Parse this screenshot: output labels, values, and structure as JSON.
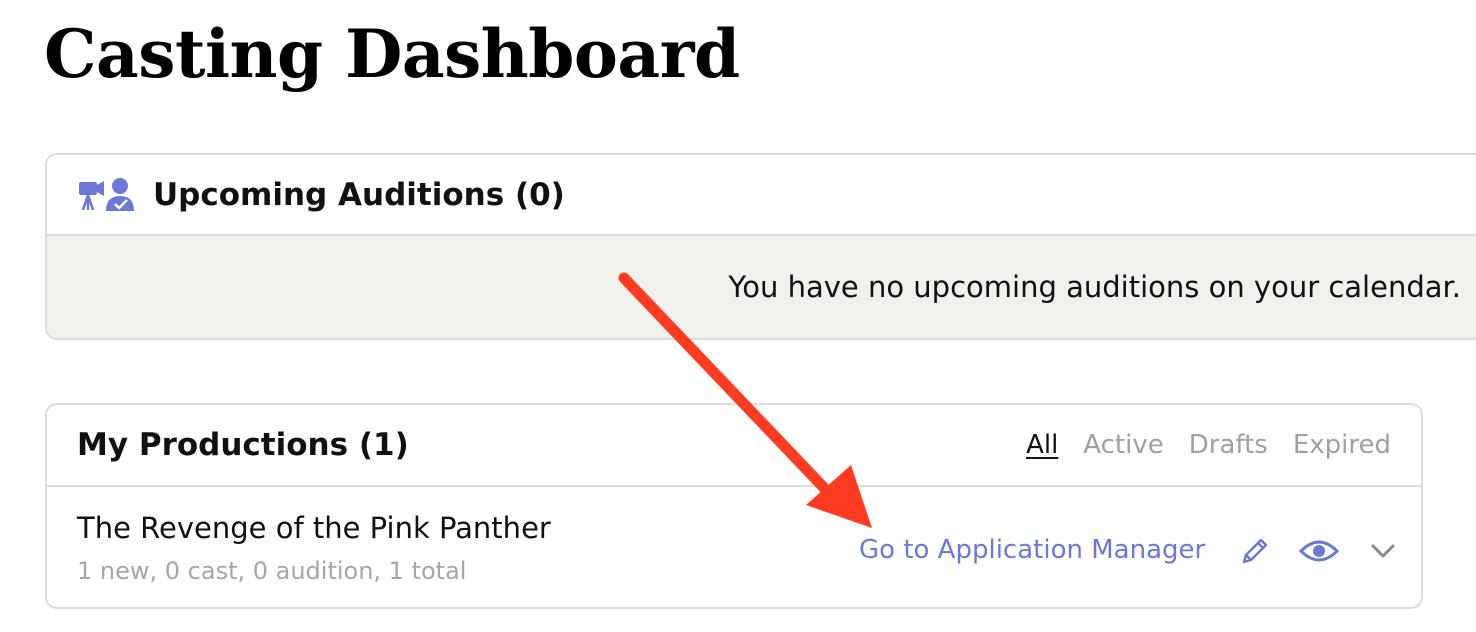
{
  "page": {
    "title": "Casting Dashboard"
  },
  "upcoming": {
    "title": "Upcoming Auditions (0)",
    "icon": "camera-person-check-icon",
    "empty_message": "You have no upcoming auditions on your calendar."
  },
  "productions": {
    "title": "My Productions (1)",
    "filters": [
      "All",
      "Active",
      "Drafts",
      "Expired"
    ],
    "selected_filter": "All",
    "items": [
      {
        "title": "The Revenge of the Pink Panther",
        "meta": "1 new, 0 cast, 0 audition, 1 total",
        "action_label": "Go to Application Manager",
        "icons": [
          "pencil-icon",
          "eye-icon",
          "chevron-down-icon"
        ]
      }
    ]
  },
  "annotation": {
    "type": "arrow",
    "color": "#ff3b22"
  },
  "colors": {
    "accent": "#6b78d6",
    "muted": "#a0a0a0",
    "panel_bg": "#f1f0ec",
    "border": "#dcdcdc"
  }
}
